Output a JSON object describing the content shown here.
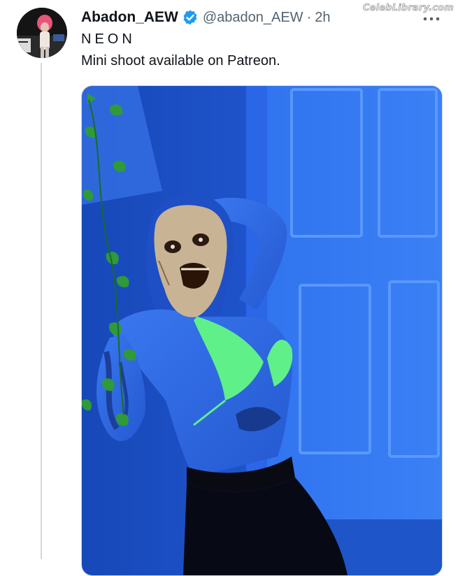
{
  "user": {
    "display_name": "Abadon_AEW",
    "handle": "@abadon_AEW",
    "separator": "·",
    "time": "2h",
    "verified": true,
    "avatar_icon": "profile-avatar"
  },
  "tweet": {
    "line1": "NEON",
    "line2": "Mini shoot available on Patreon."
  },
  "media": {
    "type": "photo",
    "description_icon": "neon-photo"
  },
  "watermark": "CelebLibrary.com",
  "colors": {
    "verified_blue": "#1d9bf0",
    "secondary_text": "#536471",
    "primary_text": "#0f1419",
    "photo_blue": "#2f6fe0",
    "bikini_green": "#5ff08a"
  }
}
